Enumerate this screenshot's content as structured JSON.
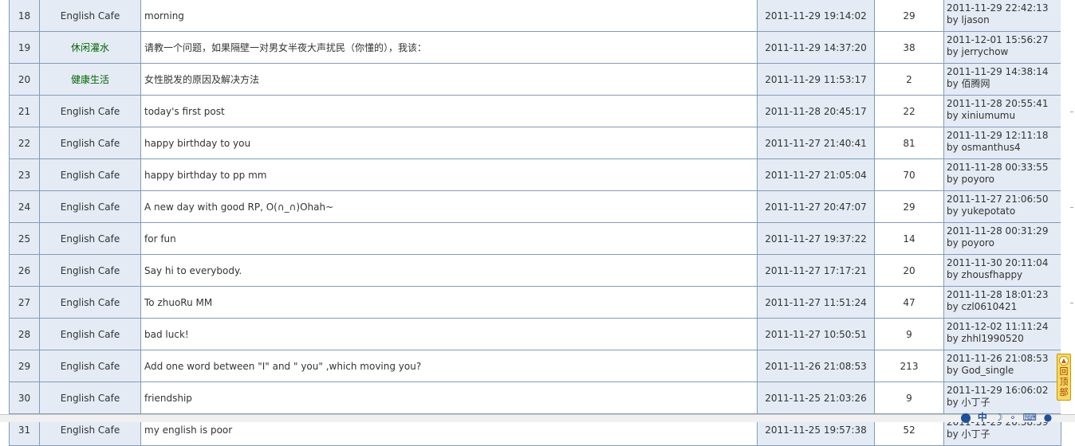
{
  "threads": [
    {
      "num": "18",
      "board": "English Cafe",
      "board_color": "#333333",
      "title": "morning",
      "posted": "2011-11-29 19:14:02",
      "replies": "29",
      "last_date": "2011-11-29 22:42:13",
      "last_by": "by ljason"
    },
    {
      "num": "19",
      "board": "休闲灌水",
      "board_color": "#006600",
      "title": "请教一个问题，如果隔壁一对男女半夜大声扰民（你懂的），我该：",
      "posted": "2011-11-29 14:37:20",
      "replies": "38",
      "last_date": "2011-12-01 15:56:27",
      "last_by": "by jerrychow"
    },
    {
      "num": "20",
      "board": "健康生活",
      "board_color": "#006600",
      "title": "女性脱发的原因及解决方法",
      "posted": "2011-11-29 11:53:17",
      "replies": "2",
      "last_date": "2011-11-29 14:38:14",
      "last_by": "by 佰腾网"
    },
    {
      "num": "21",
      "board": "English Cafe",
      "board_color": "#333333",
      "title": "today's first post",
      "posted": "2011-11-28 20:45:17",
      "replies": "22",
      "last_date": "2011-11-28 20:55:41",
      "last_by": "by xiniumumu"
    },
    {
      "num": "22",
      "board": "English Cafe",
      "board_color": "#333333",
      "title": "happy birthday to you",
      "posted": "2011-11-27 21:40:41",
      "replies": "81",
      "last_date": "2011-11-29 12:11:18",
      "last_by": "by osmanthus4"
    },
    {
      "num": "23",
      "board": "English Cafe",
      "board_color": "#333333",
      "title": "happy birthday to pp mm",
      "posted": "2011-11-27 21:05:04",
      "replies": "70",
      "last_date": "2011-11-28 00:33:55",
      "last_by": "by poyoro"
    },
    {
      "num": "24",
      "board": "English Cafe",
      "board_color": "#333333",
      "title": "A new day with good RP, O(∩_∩)Ohah~",
      "posted": "2011-11-27 20:47:07",
      "replies": "29",
      "last_date": "2011-11-27 21:06:50",
      "last_by": "by yukepotato"
    },
    {
      "num": "25",
      "board": "English Cafe",
      "board_color": "#333333",
      "title": "for fun",
      "posted": "2011-11-27 19:37:22",
      "replies": "14",
      "last_date": "2011-11-28 00:31:29",
      "last_by": "by poyoro"
    },
    {
      "num": "26",
      "board": "English Cafe",
      "board_color": "#333333",
      "title": "Say hi to everybody.",
      "posted": "2011-11-27 17:17:21",
      "replies": "20",
      "last_date": "2011-11-30 20:11:04",
      "last_by": "by zhousfhappy"
    },
    {
      "num": "27",
      "board": "English Cafe",
      "board_color": "#333333",
      "title": "To zhuoRu MM",
      "posted": "2011-11-27 11:51:24",
      "replies": "47",
      "last_date": "2011-11-28 18:01:23",
      "last_by": "by czl0610421"
    },
    {
      "num": "28",
      "board": "English Cafe",
      "board_color": "#333333",
      "title": "bad luck!",
      "posted": "2011-11-27 10:50:51",
      "replies": "9",
      "last_date": "2011-12-02 11:11:24",
      "last_by": "by zhhl1990520"
    },
    {
      "num": "29",
      "board": "English Cafe",
      "board_color": "#333333",
      "title": "Add one word between \"I\" and \" you\" ,which moving you?",
      "posted": "2011-11-26 21:08:53",
      "replies": "213",
      "last_date": "2011-11-26 21:08:53",
      "last_by": "by God_single"
    },
    {
      "num": "30",
      "board": "English Cafe",
      "board_color": "#333333",
      "title": "friendship",
      "posted": "2011-11-25 21:03:26",
      "replies": "9",
      "last_date": "2011-11-29 16:06:02",
      "last_by": "by 小丁子"
    },
    {
      "num": "31",
      "board": "English Cafe",
      "board_color": "#333333",
      "title": "my english is poor",
      "posted": "2011-11-25 19:57:38",
      "replies": "52",
      "last_date": "2011-11-29 20:38:59",
      "last_by": "by 小丁子"
    }
  ],
  "back_to_top": {
    "label": "回顶部",
    "icon": "up-arrow-icon"
  },
  "ime": {
    "lang": "中",
    "icons": [
      "ime-logo-icon",
      "moon-icon",
      "dot-icon",
      "keyboard-icon",
      "user-icon",
      "wrench-icon"
    ]
  }
}
